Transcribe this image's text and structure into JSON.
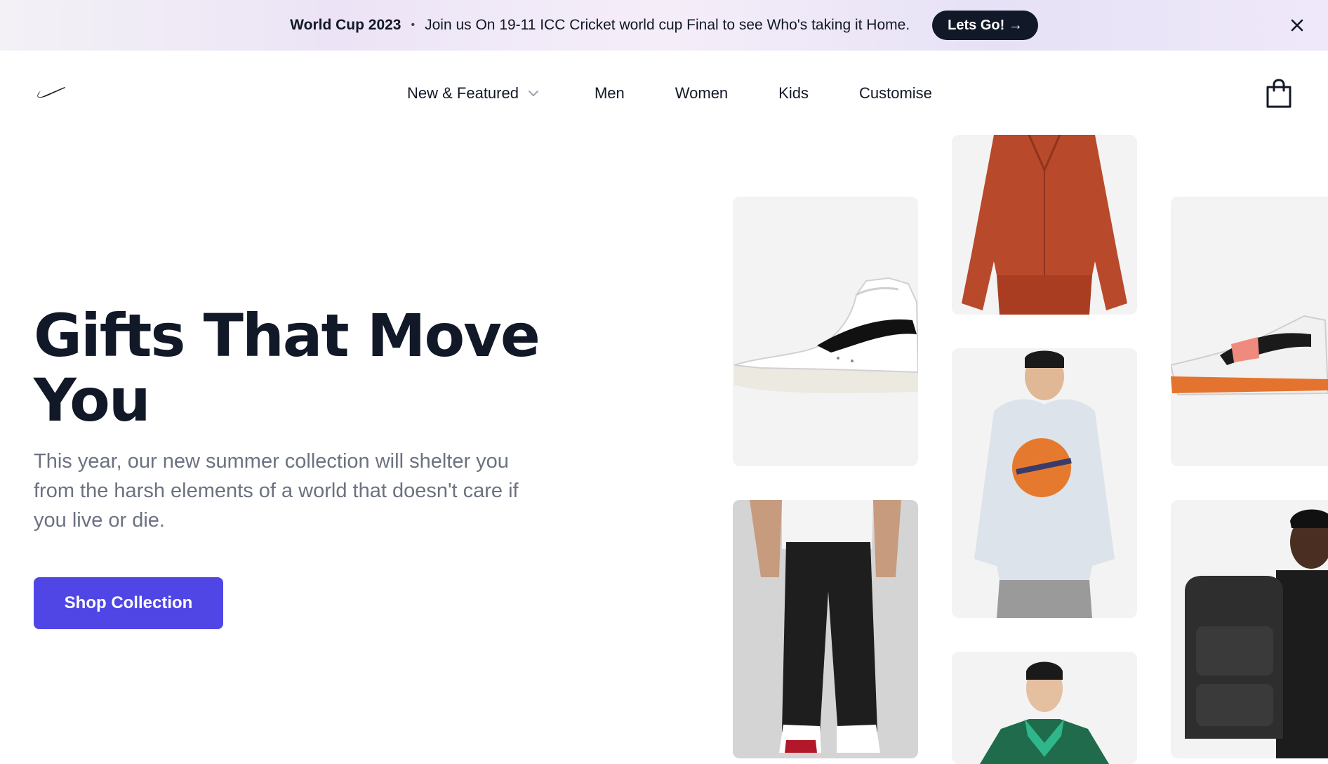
{
  "banner": {
    "title": "World Cup 2023",
    "separator": "•",
    "message": "Join us On 19-11 ICC Cricket world cup Final to see Who's taking it Home.",
    "cta_label": "Lets Go! →",
    "close_icon": "close-icon"
  },
  "nav": {
    "logo": "nike-swoosh-logo",
    "links": [
      "New & Featured",
      "Men",
      "Women",
      "Kids",
      "Customise"
    ],
    "dropdown_icon": "chevron-down-icon",
    "cart_icon": "shopping-bag-icon"
  },
  "hero": {
    "title": "Gifts That Move You",
    "subtitle": "This year, our new summer collection will shelter you from the harsh elements of a world that doesn't care if you live or die.",
    "cta_label": "Shop Collection"
  },
  "products": [
    {
      "name": "white-high-top-sneaker"
    },
    {
      "name": "rust-cardigan"
    },
    {
      "name": "running-shoe"
    },
    {
      "name": "grey-graphic-hoodie"
    },
    {
      "name": "black-track-pants"
    },
    {
      "name": "green-jacket"
    },
    {
      "name": "black-backpack"
    }
  ],
  "colors": {
    "accent": "#4f46e5",
    "text_dark": "#111827",
    "text_muted": "#6b7280",
    "tile_bg": "#f3f3f3"
  }
}
